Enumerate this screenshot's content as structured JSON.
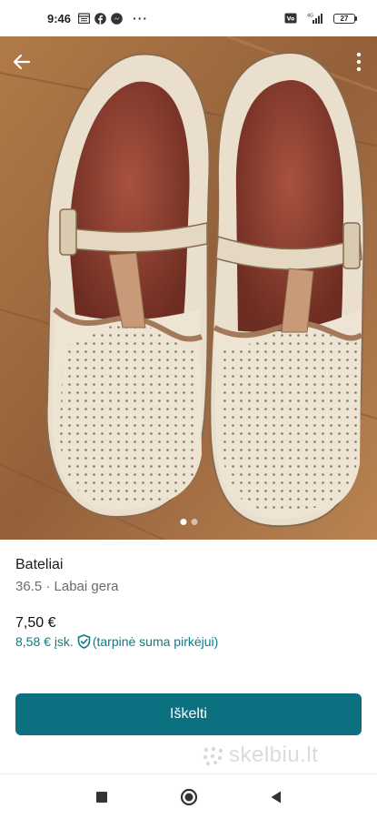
{
  "status_bar": {
    "time": "9:46",
    "battery": "27",
    "network": "4G",
    "overflow": "···"
  },
  "listing": {
    "title": "Bateliai",
    "subtitle": "36.5 · Labai gera",
    "price": "7,50 €",
    "price_with_protection": "8,58 € įsk.",
    "protection_note": "(tarpinė suma pirkėjui)",
    "photo_count": 2,
    "photo_active_index": 1
  },
  "actions": {
    "primary_label": "Iškelti"
  },
  "watermark": "skelbiu.lt",
  "icons": {
    "back": "arrow-left-icon",
    "more": "more-vertical-icon",
    "shield": "shield-check-icon",
    "nav_recent": "square-icon",
    "nav_home": "circle-icon",
    "nav_back": "triangle-back-icon"
  },
  "colors": {
    "accent": "#0b7180",
    "protection_text": "#0f7a85"
  }
}
